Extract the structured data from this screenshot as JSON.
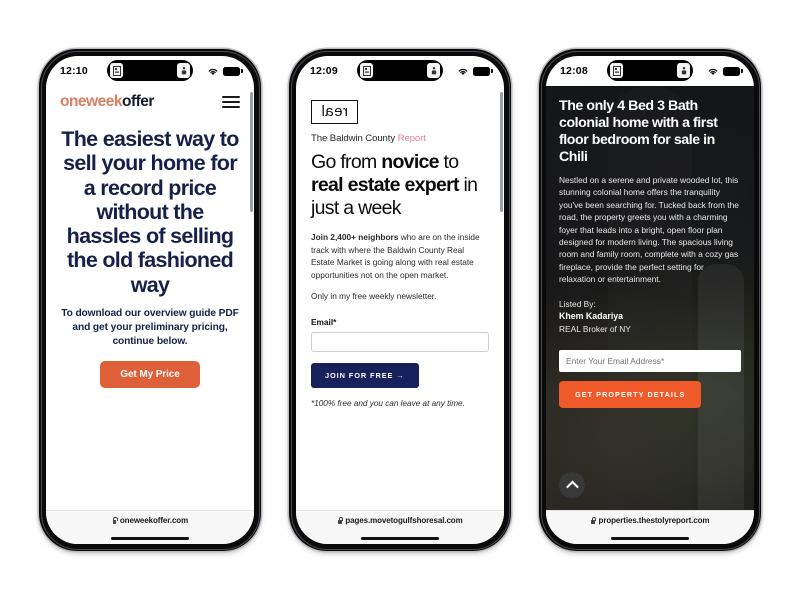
{
  "phones": [
    {
      "status": {
        "time": "12:10",
        "wifi_icon": "wifi-icon",
        "battery_icon": "battery-icon"
      },
      "url": "oneweekoffer.com",
      "site": {
        "logo_part1": "oneweek",
        "logo_part2": "offer",
        "menu_icon": "hamburger-menu-icon",
        "headline": "The easiest way to sell your home for a record price without the hassles of selling the old fashioned way",
        "subhead": "To download our overview guide PDF and get your preliminary pricing, continue below.",
        "cta_label": "Get My Price",
        "accent_color": "#d98060",
        "headline_color": "#16214a",
        "cta_color": "#df5f38"
      }
    },
    {
      "status": {
        "time": "12:09",
        "wifi_icon": "wifi-icon",
        "battery_icon": "battery-icon"
      },
      "url": "pages.movetogulfshoresal.com",
      "site": {
        "logo_text": "real",
        "kicker_plain": "The Baldwin County ",
        "kicker_accent": "Report",
        "headline_segments": [
          {
            "text": "Go from ",
            "bold": false
          },
          {
            "text": "novice",
            "bold": true
          },
          {
            "text": " to ",
            "bold": false
          },
          {
            "text": "real estate expert",
            "bold": true
          },
          {
            "text": " in just a week",
            "bold": false
          }
        ],
        "para_bold": "Join 2,400+ neighbors",
        "para_rest": " who are on the inside track with where the Baldwin County Real Estate Market is going along with real estate opportunities not on the open market.",
        "para2": "Only in my free weekly newsletter.",
        "field_label": "Email*",
        "field_value": "",
        "field_placeholder": "",
        "cta_label": "JOIN FOR FREE  →",
        "fine_print": "*100% free and you can leave at any time.",
        "accent_color": "#e4859c",
        "cta_color": "#17215c"
      }
    },
    {
      "status": {
        "time": "12:08",
        "wifi_icon": "wifi-icon",
        "battery_icon": "battery-icon"
      },
      "url": "properties.thestolyreport.com",
      "site": {
        "headline": "The only 4 Bed 3 Bath colonial home with a first floor bedroom for sale in Chili",
        "description": "Nestled on a serene and private wooded lot, this stunning colonial home offers the tranquility you've been searching for. Tucked back from the road, the property greets you with a charming foyer that leads into a bright, open floor plan designed for modern living. The spacious living room and family room, complete with a cozy gas fireplace, provide the perfect setting for relaxation or entertainment.",
        "listed_by_label": "Listed By:",
        "agent_name": "Khem Kadariya",
        "agent_brokerage": "REAL Broker of NY",
        "email_placeholder": "Enter Your Email Address*",
        "email_value": "",
        "cta_label": "GET PROPERTY DETAILS",
        "scroll_top_icon": "chevron-up-icon",
        "cta_color": "#f05a2b"
      }
    }
  ]
}
